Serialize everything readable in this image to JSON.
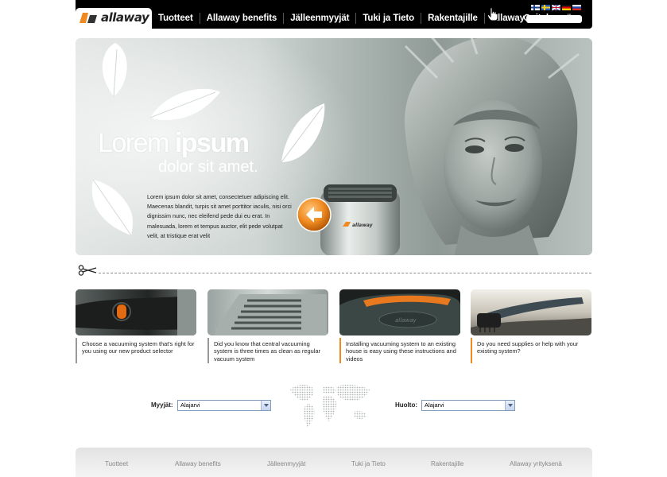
{
  "brand": {
    "name": "allaway",
    "accent": "#f08a20"
  },
  "nav": {
    "items": [
      {
        "label": "Tuotteet"
      },
      {
        "label": "Allaway benefits"
      },
      {
        "label": "Jälleenmyyjät"
      },
      {
        "label": "Tuki ja Tieto"
      },
      {
        "label": "Rakentajille"
      },
      {
        "label": "Allaway yrityksenä"
      }
    ]
  },
  "languages": [
    "finnish-flag-icon",
    "swedish-flag-icon",
    "uk-flag-icon",
    "german-flag-icon",
    "russian-flag-icon"
  ],
  "search": {
    "value": ""
  },
  "hero": {
    "title_regular": "Lorem ",
    "title_bold": "ipsum",
    "subtitle": "dolor sit amet.",
    "body": "Lorem ipsum dolor sit amet, consectetuer adipiscing elit. Maecenas blandit, turpis sit amet porttitor iaculis, nisi orci dignissim nunc, nec eleifend pede dui eu erat. In malesuada, lorem et tempus auctor, elit pede volutpat velit, at tristique erat velit",
    "product_label": "allaway"
  },
  "cards": [
    {
      "text": "Choose a vacuuming system that's right for you using our new product selector"
    },
    {
      "text": "Did you know that central vacuuming system is three times as clean as regular vacuum system"
    },
    {
      "text": "Installing vacuuming system to an existing house is easy using these instructions and videos"
    },
    {
      "text": "Do you need supplies or help with your existing system?"
    }
  ],
  "dealers": {
    "left_label": "Myyjät:",
    "left_value": "Alajarvi",
    "right_label": "Huolto:",
    "right_value": "Alajarvi"
  },
  "footer": {
    "items": [
      {
        "label": "Tuotteet"
      },
      {
        "label": "Allaway benefits"
      },
      {
        "label": "Jälleenmyyjät"
      },
      {
        "label": "Tuki ja Tieto"
      },
      {
        "label": "Rakentajille"
      },
      {
        "label": "Allaway yrityksenä"
      }
    ]
  }
}
